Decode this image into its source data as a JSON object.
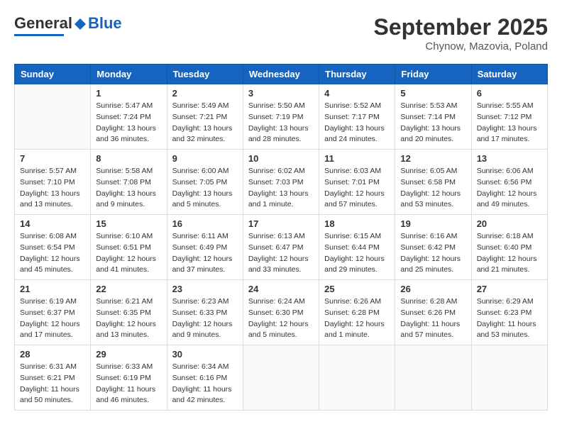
{
  "header": {
    "logo_general": "General",
    "logo_blue": "Blue",
    "month_title": "September 2025",
    "location": "Chynow, Mazovia, Poland"
  },
  "weekdays": [
    "Sunday",
    "Monday",
    "Tuesday",
    "Wednesday",
    "Thursday",
    "Friday",
    "Saturday"
  ],
  "weeks": [
    [
      {
        "day": "",
        "info": ""
      },
      {
        "day": "1",
        "info": "Sunrise: 5:47 AM\nSunset: 7:24 PM\nDaylight: 13 hours\nand 36 minutes."
      },
      {
        "day": "2",
        "info": "Sunrise: 5:49 AM\nSunset: 7:21 PM\nDaylight: 13 hours\nand 32 minutes."
      },
      {
        "day": "3",
        "info": "Sunrise: 5:50 AM\nSunset: 7:19 PM\nDaylight: 13 hours\nand 28 minutes."
      },
      {
        "day": "4",
        "info": "Sunrise: 5:52 AM\nSunset: 7:17 PM\nDaylight: 13 hours\nand 24 minutes."
      },
      {
        "day": "5",
        "info": "Sunrise: 5:53 AM\nSunset: 7:14 PM\nDaylight: 13 hours\nand 20 minutes."
      },
      {
        "day": "6",
        "info": "Sunrise: 5:55 AM\nSunset: 7:12 PM\nDaylight: 13 hours\nand 17 minutes."
      }
    ],
    [
      {
        "day": "7",
        "info": "Sunrise: 5:57 AM\nSunset: 7:10 PM\nDaylight: 13 hours\nand 13 minutes."
      },
      {
        "day": "8",
        "info": "Sunrise: 5:58 AM\nSunset: 7:08 PM\nDaylight: 13 hours\nand 9 minutes."
      },
      {
        "day": "9",
        "info": "Sunrise: 6:00 AM\nSunset: 7:05 PM\nDaylight: 13 hours\nand 5 minutes."
      },
      {
        "day": "10",
        "info": "Sunrise: 6:02 AM\nSunset: 7:03 PM\nDaylight: 13 hours\nand 1 minute."
      },
      {
        "day": "11",
        "info": "Sunrise: 6:03 AM\nSunset: 7:01 PM\nDaylight: 12 hours\nand 57 minutes."
      },
      {
        "day": "12",
        "info": "Sunrise: 6:05 AM\nSunset: 6:58 PM\nDaylight: 12 hours\nand 53 minutes."
      },
      {
        "day": "13",
        "info": "Sunrise: 6:06 AM\nSunset: 6:56 PM\nDaylight: 12 hours\nand 49 minutes."
      }
    ],
    [
      {
        "day": "14",
        "info": "Sunrise: 6:08 AM\nSunset: 6:54 PM\nDaylight: 12 hours\nand 45 minutes."
      },
      {
        "day": "15",
        "info": "Sunrise: 6:10 AM\nSunset: 6:51 PM\nDaylight: 12 hours\nand 41 minutes."
      },
      {
        "day": "16",
        "info": "Sunrise: 6:11 AM\nSunset: 6:49 PM\nDaylight: 12 hours\nand 37 minutes."
      },
      {
        "day": "17",
        "info": "Sunrise: 6:13 AM\nSunset: 6:47 PM\nDaylight: 12 hours\nand 33 minutes."
      },
      {
        "day": "18",
        "info": "Sunrise: 6:15 AM\nSunset: 6:44 PM\nDaylight: 12 hours\nand 29 minutes."
      },
      {
        "day": "19",
        "info": "Sunrise: 6:16 AM\nSunset: 6:42 PM\nDaylight: 12 hours\nand 25 minutes."
      },
      {
        "day": "20",
        "info": "Sunrise: 6:18 AM\nSunset: 6:40 PM\nDaylight: 12 hours\nand 21 minutes."
      }
    ],
    [
      {
        "day": "21",
        "info": "Sunrise: 6:19 AM\nSunset: 6:37 PM\nDaylight: 12 hours\nand 17 minutes."
      },
      {
        "day": "22",
        "info": "Sunrise: 6:21 AM\nSunset: 6:35 PM\nDaylight: 12 hours\nand 13 minutes."
      },
      {
        "day": "23",
        "info": "Sunrise: 6:23 AM\nSunset: 6:33 PM\nDaylight: 12 hours\nand 9 minutes."
      },
      {
        "day": "24",
        "info": "Sunrise: 6:24 AM\nSunset: 6:30 PM\nDaylight: 12 hours\nand 5 minutes."
      },
      {
        "day": "25",
        "info": "Sunrise: 6:26 AM\nSunset: 6:28 PM\nDaylight: 12 hours\nand 1 minute."
      },
      {
        "day": "26",
        "info": "Sunrise: 6:28 AM\nSunset: 6:26 PM\nDaylight: 11 hours\nand 57 minutes."
      },
      {
        "day": "27",
        "info": "Sunrise: 6:29 AM\nSunset: 6:23 PM\nDaylight: 11 hours\nand 53 minutes."
      }
    ],
    [
      {
        "day": "28",
        "info": "Sunrise: 6:31 AM\nSunset: 6:21 PM\nDaylight: 11 hours\nand 50 minutes."
      },
      {
        "day": "29",
        "info": "Sunrise: 6:33 AM\nSunset: 6:19 PM\nDaylight: 11 hours\nand 46 minutes."
      },
      {
        "day": "30",
        "info": "Sunrise: 6:34 AM\nSunset: 6:16 PM\nDaylight: 11 hours\nand 42 minutes."
      },
      {
        "day": "",
        "info": ""
      },
      {
        "day": "",
        "info": ""
      },
      {
        "day": "",
        "info": ""
      },
      {
        "day": "",
        "info": ""
      }
    ]
  ]
}
